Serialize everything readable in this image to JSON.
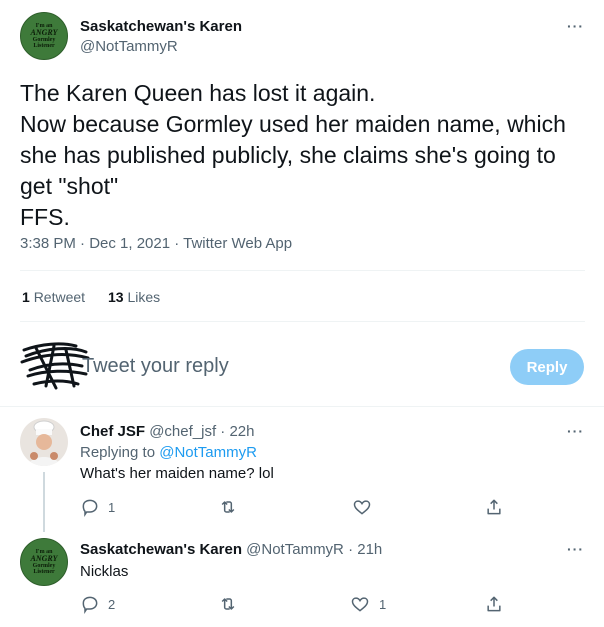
{
  "main_tweet": {
    "author_name": "Saskatchewan's Karen",
    "author_handle": "@NotTammyR",
    "avatar_text": [
      "I'm an",
      "ANGRY",
      "Gormley",
      "Listener"
    ],
    "text_lines": [
      "The Karen Queen has lost it again.",
      "Now because Gormley used her maiden name, which",
      "she has published publicly, she claims she's going to",
      "get \"shot\"",
      "FFS."
    ],
    "timestamp": "3:38 PM · Dec 1, 2021 · Twitter Web App",
    "retweets_count": "1",
    "retweets_label": "Retweet",
    "likes_count": "13",
    "likes_label": "Likes",
    "more_label": "···"
  },
  "compose": {
    "placeholder": "Tweet your reply",
    "reply_button": "Reply"
  },
  "replies": [
    {
      "author_name": "Chef JSF",
      "author_handle": "@chef_jsf",
      "time": "· 22h",
      "replying_to_label": "Replying to",
      "replying_to_handle": "@NotTammyR",
      "text": "What's her maiden name? lol",
      "reply_count": "1",
      "like_count": "",
      "more_label": "···"
    },
    {
      "author_name": "Saskatchewan's Karen",
      "author_handle": "@NotTammyR",
      "time": "· 21h",
      "avatar_text": [
        "I'm an",
        "ANGRY",
        "Gormley",
        "Listener"
      ],
      "text": "Nicklas",
      "reply_count": "2",
      "like_count": "1",
      "more_label": "···"
    }
  ],
  "colors": {
    "accent": "#1d9bf0",
    "reply_button_bg": "#8ecdf7",
    "avatar_green": "#3e7a3a",
    "secondary_text": "#536471"
  }
}
